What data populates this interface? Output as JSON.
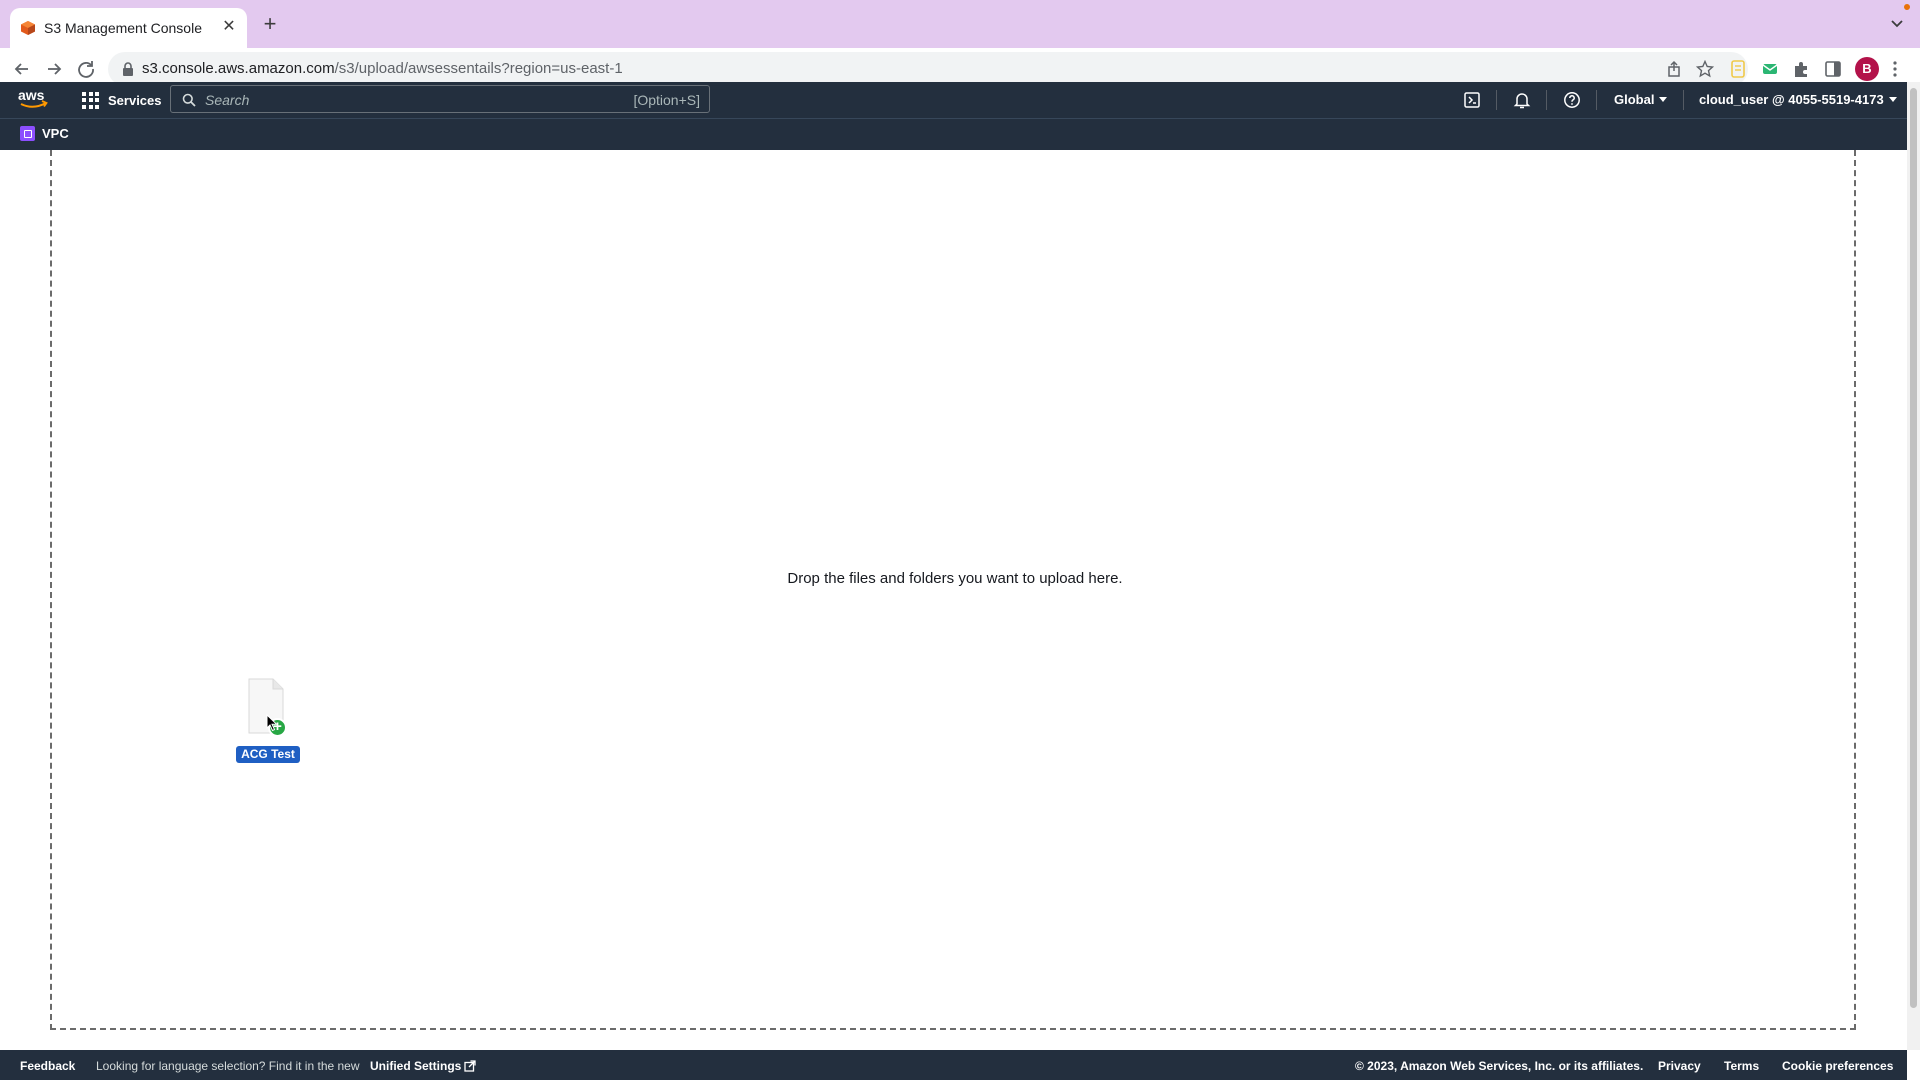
{
  "browser": {
    "tab_title": "S3 Management Console",
    "url_host": "s3.console.aws.amazon.com",
    "url_path": "/s3/upload/awsessentails?region=us-east-1",
    "profile_initial": "B"
  },
  "aws_header": {
    "services_label": "Services",
    "search_placeholder": "Search",
    "search_shortcut": "[Option+S]",
    "region_label": "Global",
    "account_label": "cloud_user @ 4055-5519-4173"
  },
  "favorites": {
    "items": [
      {
        "label": "VPC",
        "icon": "vpc-icon"
      }
    ]
  },
  "upload": {
    "drop_text": "Drop the files and folders you want to upload here.",
    "dragged_file_label": "ACG Test"
  },
  "footer": {
    "feedback": "Feedback",
    "language_notice": "Looking for language selection? Find it in the new",
    "unified_settings": "Unified Settings",
    "copyright": "© 2023, Amazon Web Services, Inc. or its affiliates.",
    "privacy": "Privacy",
    "terms": "Terms",
    "cookie_preferences": "Cookie preferences"
  },
  "colors": {
    "tab_strip": "#e3c9ef",
    "aws_header": "#232f3e",
    "vpc_badge": "#8c4fff",
    "file_label": "#1f5fc3",
    "plus_badge": "#27a744",
    "aws_orange": "#ff9900"
  }
}
